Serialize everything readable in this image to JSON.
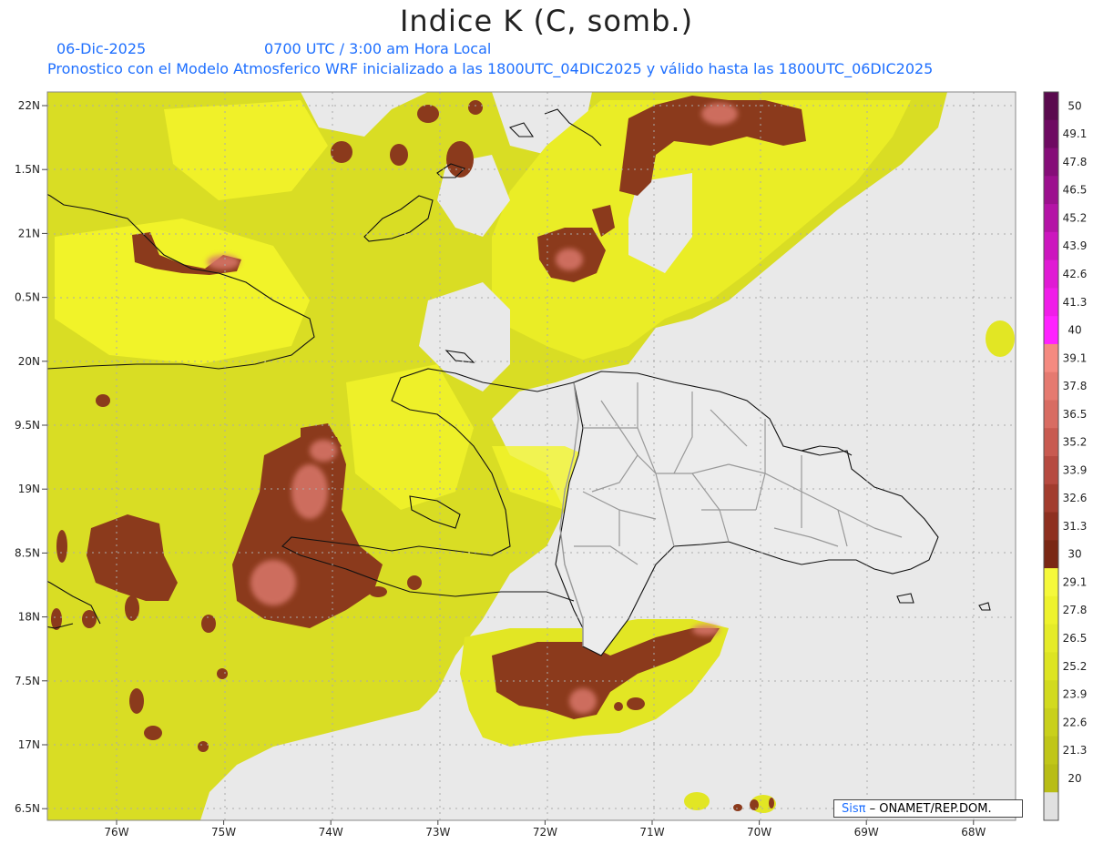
{
  "header": {
    "title": "Indice K (C, somb.)",
    "date": "06-Dic-2025",
    "time": "0700 UTC / 3:00 am Hora Local",
    "forecast_note": "Pronostico con el Modelo Atmosferico WRF inicializado a las 1800UTC_04DIC2025 y válido hasta las  1800UTC_06DIC2025"
  },
  "map": {
    "lat_labels": [
      "22N",
      "1.5N",
      "21N",
      "0.5N",
      "20N",
      "9.5N",
      "19N",
      "8.5N",
      "18N",
      "7.5N",
      "17N",
      "6.5N"
    ],
    "lon_labels": [
      "76W",
      "75W",
      "74W",
      "73W",
      "72W",
      "71W",
      "70W",
      "69W",
      "68W"
    ],
    "colors": {
      "ocean": "#e9e9e9",
      "land_border": "#111111",
      "province_border": "#999999",
      "yellow_low": "#c9c21a",
      "yellow_high": "#f3f52a",
      "brown": "#8b3a1c",
      "salmon": "#d9776a"
    }
  },
  "legend": {
    "labels": [
      "50",
      "49.1",
      "47.8",
      "46.5",
      "45.2",
      "43.9",
      "42.6",
      "41.3",
      "40",
      "39.1",
      "37.8",
      "36.5",
      "35.2",
      "33.9",
      "32.6",
      "31.3",
      "30",
      "29.1",
      "27.8",
      "26.5",
      "25.2",
      "23.9",
      "22.6",
      "21.3",
      "20"
    ],
    "colors": [
      "#5a0a4e",
      "#6e0a62",
      "#850d78",
      "#9c108e",
      "#b413a6",
      "#cc16be",
      "#e01ad4",
      "#f01de8",
      "#ff22ff",
      "#f48a80",
      "#e57a70",
      "#d86c62",
      "#c85a50",
      "#b64a40",
      "#a23c2e",
      "#8e3020",
      "#7a2814",
      "#f5f83a",
      "#eef22c",
      "#e5eb28",
      "#dde422",
      "#d2da1e",
      "#c9d01b",
      "#c0c618",
      "#b8bd15",
      "#e0e0e0"
    ]
  },
  "credit": {
    "brand": "Sisπ",
    "text": "– ONAMET/REP.DOM."
  }
}
